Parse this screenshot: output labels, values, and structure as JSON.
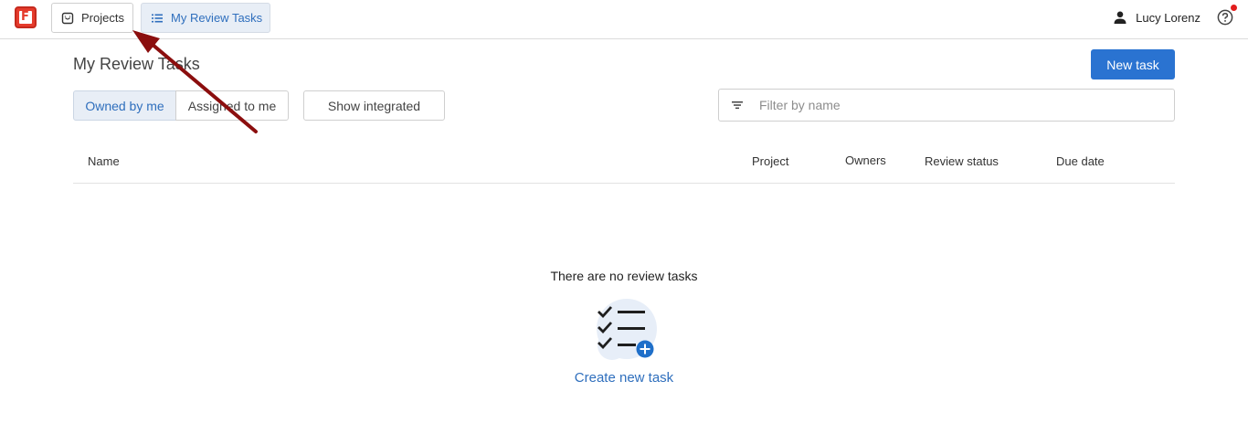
{
  "app": {
    "logo_letter": "F"
  },
  "nav": {
    "projects_label": "Projects",
    "tasks_label": "My Review Tasks"
  },
  "user": {
    "name": "Lucy Lorenz"
  },
  "page": {
    "title": "My Review Tasks",
    "new_task_label": "New task"
  },
  "filters": {
    "owned_label": "Owned by me",
    "assigned_label": "Assigned to me",
    "show_integrated_label": "Show integrated",
    "filter_placeholder": "Filter by name"
  },
  "table": {
    "columns": [
      "Name",
      "Project",
      "Owners",
      "Review status",
      "Due date"
    ]
  },
  "empty_state": {
    "message": "There are no review tasks",
    "create_label": "Create new task"
  },
  "colors": {
    "accent": "#2a73d1",
    "annotation_arrow": "#8b0e0e",
    "notification_dot": "#e21d1d"
  }
}
